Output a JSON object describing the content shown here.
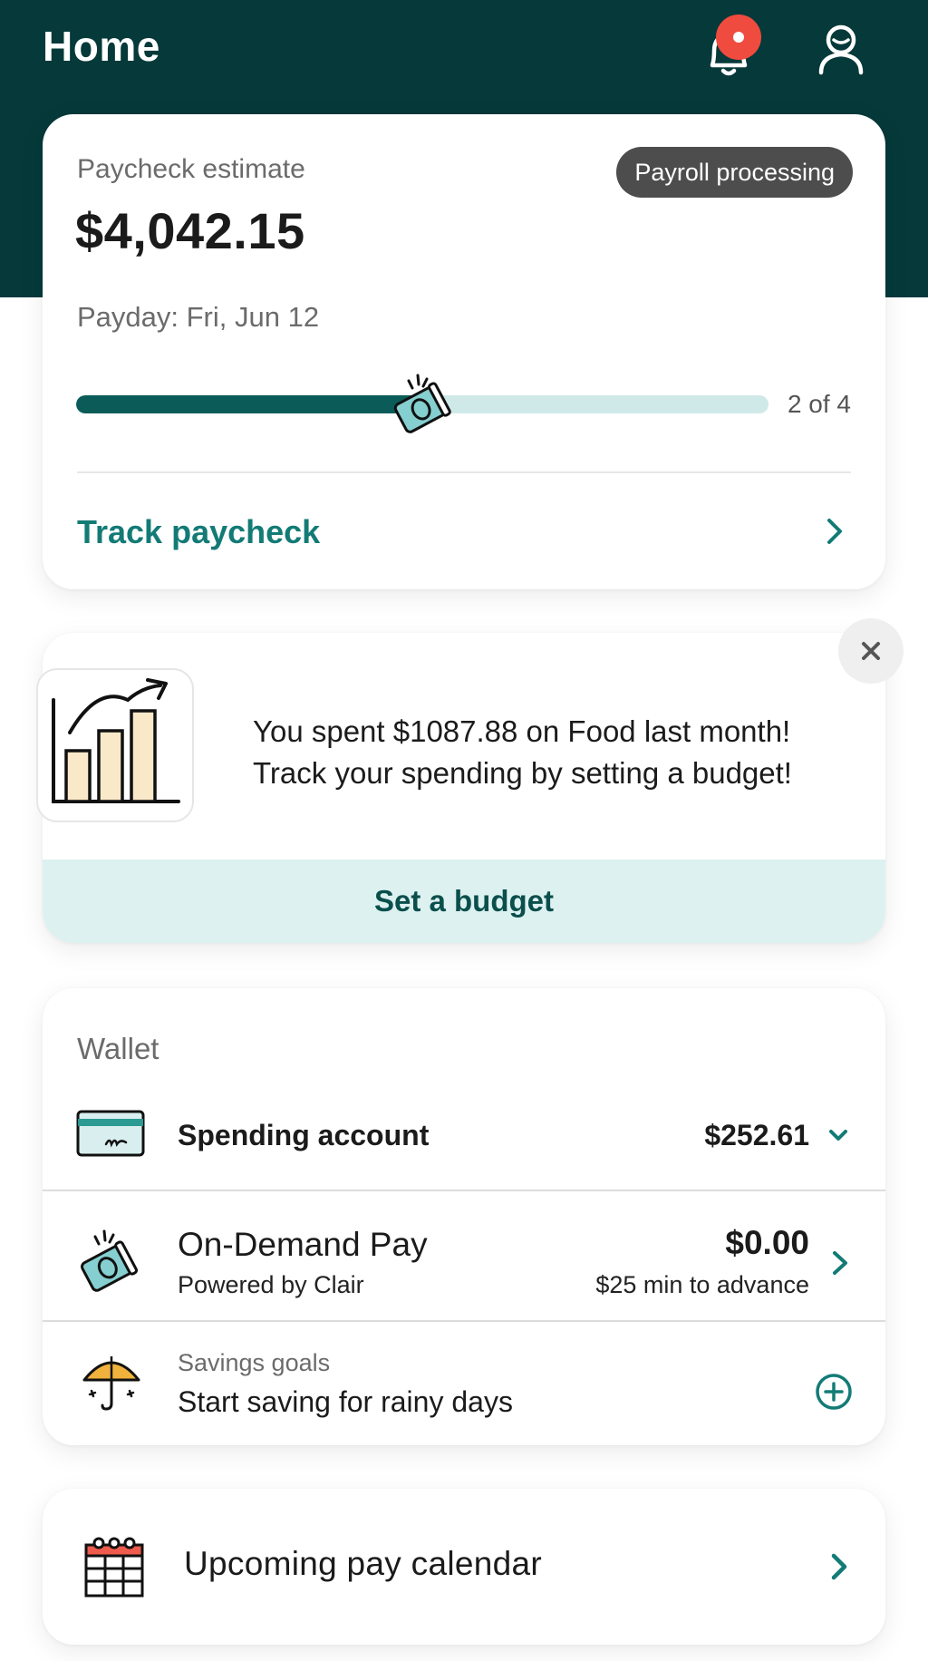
{
  "header": {
    "title": "Home",
    "notification_dot": true
  },
  "paycheck": {
    "label": "Paycheck estimate",
    "amount": "$4,042.15",
    "status_badge": "Payroll processing",
    "payday": "Payday: Fri, Jun 12",
    "progress": {
      "current": 2,
      "total": 4,
      "text": "2 of 4"
    },
    "track_label": "Track paycheck"
  },
  "budget_promo": {
    "message": "You spent $1087.88 on Food last month! Track your spending by setting a budget!",
    "cta_label": "Set a budget"
  },
  "wallet": {
    "title": "Wallet",
    "spending": {
      "label": "Spending account",
      "amount": "$252.61"
    },
    "on_demand": {
      "label": "On-Demand Pay",
      "sub": "Powered by Clair",
      "amount": "$0.00",
      "min_note": "$25 min to advance"
    },
    "savings": {
      "caption": "Savings goals",
      "label": "Start saving for rainy days"
    }
  },
  "calendar": {
    "label": "Upcoming pay calendar"
  },
  "colors": {
    "header_bg": "#05393a",
    "accent": "#137b76",
    "progress_fill": "#0b5c58",
    "progress_track": "#cfe9e8",
    "cta_bg": "#ddf1f0",
    "badge_bg": "#4d4d4d",
    "notification": "#ef4b3f"
  }
}
